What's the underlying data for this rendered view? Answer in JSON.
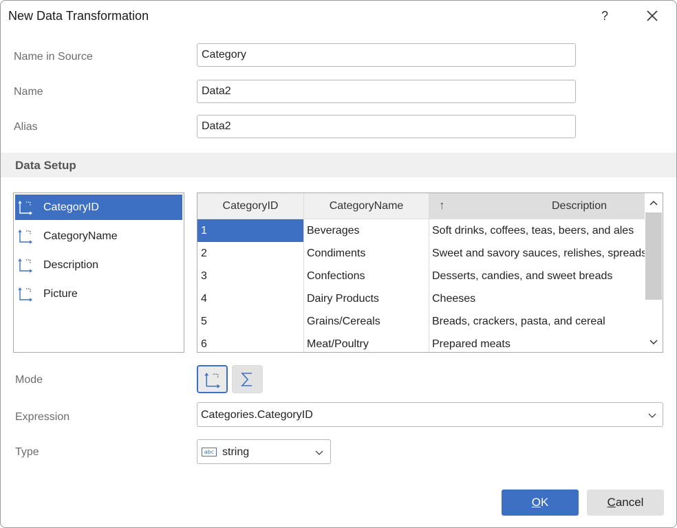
{
  "window": {
    "title": "New Data Transformation",
    "help_label": "?"
  },
  "fields": {
    "name_in_source": {
      "label": "Name in Source",
      "value": "Category"
    },
    "name": {
      "label": "Name",
      "value": "Data2"
    },
    "alias": {
      "label": "Alias",
      "value": "Data2"
    }
  },
  "data_setup": {
    "title": "Data Setup",
    "columns": [
      {
        "label": "CategoryID",
        "selected": true,
        "icon": "dimension-icon"
      },
      {
        "label": "CategoryName",
        "selected": false,
        "icon": "dimension-icon"
      },
      {
        "label": "Description",
        "selected": false,
        "icon": "dimension-icon"
      },
      {
        "label": "Picture",
        "selected": false,
        "icon": "dimension-icon"
      }
    ],
    "grid": {
      "headers": [
        "CategoryID",
        "CategoryName",
        "Description"
      ],
      "sort_icon": "sort-arrow-icon",
      "sort_glyph": "↑",
      "rows": [
        [
          "1",
          "Beverages",
          "Soft drinks, coffees, teas, beers, and ales"
        ],
        [
          "2",
          "Condiments",
          "Sweet and savory sauces, relishes, spreads"
        ],
        [
          "3",
          "Confections",
          "Desserts, candies, and sweet breads"
        ],
        [
          "4",
          "Dairy Products",
          "Cheeses"
        ],
        [
          "5",
          "Grains/Cereals",
          "Breads, crackers, pasta, and cereal"
        ],
        [
          "6",
          "Meat/Poultry",
          "Prepared meats"
        ]
      ],
      "selected_cell": "1"
    }
  },
  "mode": {
    "label": "Mode",
    "options": [
      "dimension-icon",
      "sum-icon"
    ],
    "active": "dimension-icon"
  },
  "expression": {
    "label": "Expression",
    "value": "Categories.CategoryID"
  },
  "type": {
    "label": "Type",
    "value": "string",
    "icon": "abc-type-icon",
    "icon_text": "abc"
  },
  "buttons": {
    "ok": {
      "accel": "O",
      "rest": "K"
    },
    "cancel": {
      "accel": "C",
      "rest": "ancel"
    }
  },
  "colors": {
    "accent": "#3d6fc2",
    "band": "#f0f0f0",
    "label": "#6b6b6b"
  }
}
